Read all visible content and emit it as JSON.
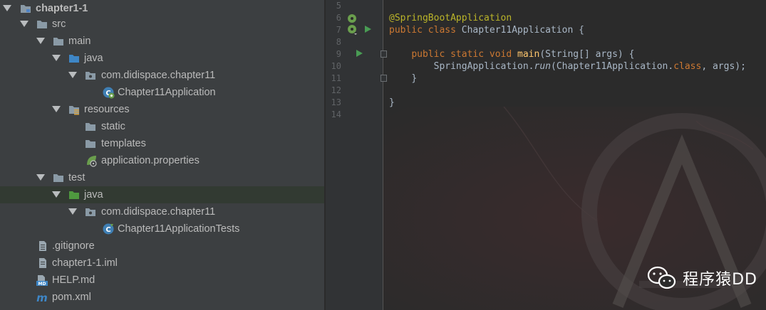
{
  "project_tree": {
    "items": [
      {
        "label": "chapter1-1"
      },
      {
        "label": "src"
      },
      {
        "label": "main"
      },
      {
        "label": "java"
      },
      {
        "label": "com.didispace.chapter11"
      },
      {
        "label": "Chapter11Application"
      },
      {
        "label": "resources"
      },
      {
        "label": "static"
      },
      {
        "label": "templates"
      },
      {
        "label": "application.properties"
      },
      {
        "label": "test"
      },
      {
        "label": "java"
      },
      {
        "label": "com.didispace.chapter11"
      },
      {
        "label": "Chapter11ApplicationTests"
      },
      {
        "label": ".gitignore"
      },
      {
        "label": "chapter1-1.iml"
      },
      {
        "label": "HELP.md"
      },
      {
        "label": "pom.xml"
      }
    ]
  },
  "editor": {
    "line_numbers": [
      "5",
      "6",
      "7",
      "8",
      "9",
      "10",
      "11",
      "12",
      "13",
      "14"
    ],
    "code": {
      "l6_annotation": "@SpringBootApplication",
      "l7_kw": "public class",
      "l7_name": " Chapter11Application {",
      "l9_kw": "public static void",
      "l9_fn": " main",
      "l9_rest": "(String[] args) {",
      "l10_a": "SpringApplication.",
      "l10_run": "run",
      "l10_b": "(Chapter11Application.",
      "l10_class": "class",
      "l10_c": ", args);",
      "l11": "}",
      "l13": "}"
    }
  },
  "watermark": {
    "text": "程序猿DD"
  },
  "colors": {
    "tree_bg": "#3c3f41",
    "editor_bg": "#2b2b2b",
    "keyword": "#cc7832",
    "annotation": "#bbb529",
    "method": "#ffc66d",
    "text": "#a9b7c6"
  }
}
